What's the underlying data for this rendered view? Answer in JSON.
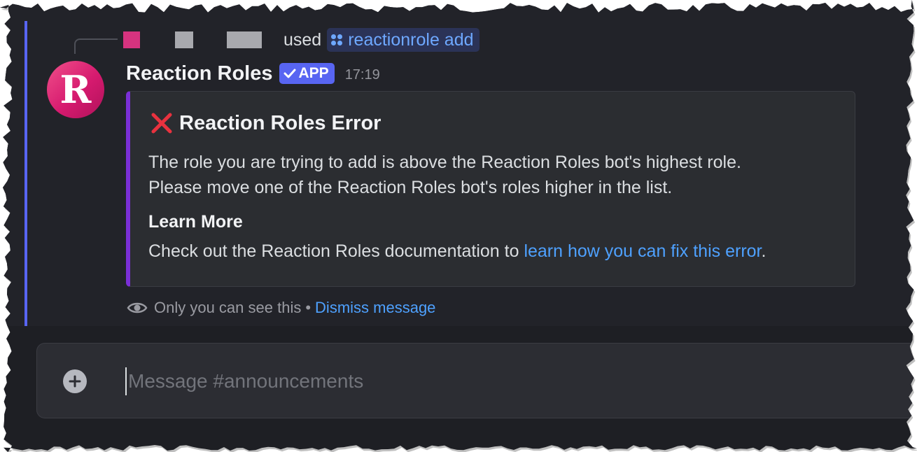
{
  "reply": {
    "used_label": "used",
    "command": "reactionrole add"
  },
  "message": {
    "avatar_letter": "R",
    "author": "Reaction Roles",
    "badge": "APP",
    "timestamp": "17:19"
  },
  "embed": {
    "accent_color": "#7a2fd6",
    "title": "Reaction Roles Error",
    "description_line1": "The role you are trying to add is above the Reaction Roles bot's highest role.",
    "description_line2": "Please move one of the Reaction Roles bot's roles higher in the list.",
    "field_name": "Learn More",
    "field_value_prefix": "Check out the Reaction Roles documentation to ",
    "field_link": "learn how you can fix this error",
    "field_value_suffix": "."
  },
  "ephemeral": {
    "notice": "Only you can see this",
    "separator": "•",
    "dismiss": "Dismiss message"
  },
  "composer": {
    "placeholder": "Message #announcements"
  },
  "colors": {
    "mention_highlight": "#5865f2",
    "link": "#4ea1ff",
    "avatar": "#d61a6f"
  },
  "icons": [
    "command-icon",
    "checkmark-icon",
    "red-x-icon",
    "eye-icon",
    "plus-circle-icon"
  ]
}
